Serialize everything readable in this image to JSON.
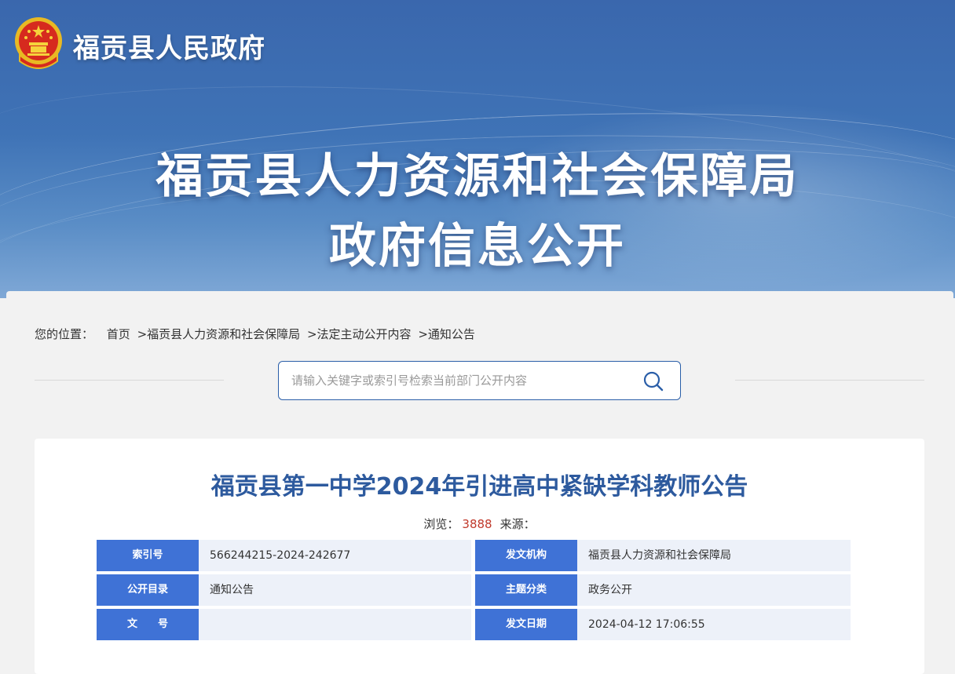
{
  "header": {
    "gov_name": "福贡县人民政府",
    "title_line1": "福贡县人力资源和社会保障局",
    "title_line2": "政府信息公开"
  },
  "breadcrumb": {
    "prefix": "您的位置：",
    "items": [
      "首页",
      ">福贡县人力资源和社会保障局",
      ">法定主动公开内容",
      ">通知公告"
    ]
  },
  "search": {
    "placeholder": "请输入关键字或索引号检索当前部门公开内容"
  },
  "article": {
    "title": "福贡县第一中学2024年引进高中紧缺学科教师公告",
    "views_label": "浏览：",
    "views": "3888",
    "source_label": "来源："
  },
  "info": {
    "rows": [
      {
        "label1": "索引号",
        "value1": "566244215-2024-242677",
        "label2": "发文机构",
        "value2": "福贡县人力资源和社会保障局"
      },
      {
        "label1": "公开目录",
        "value1": "通知公告",
        "label2": "主题分类",
        "value2": "政务公开"
      },
      {
        "label1": "文　　号",
        "value1": "",
        "label2": "发文日期",
        "value2": "2024-04-12 17:06:55"
      }
    ]
  },
  "colors": {
    "banner": "#3f73b6",
    "accent": "#3f72d6",
    "title": "#2d5a9e",
    "view_count": "#c0392b"
  },
  "icons": [
    "national-emblem-icon",
    "search-icon"
  ]
}
